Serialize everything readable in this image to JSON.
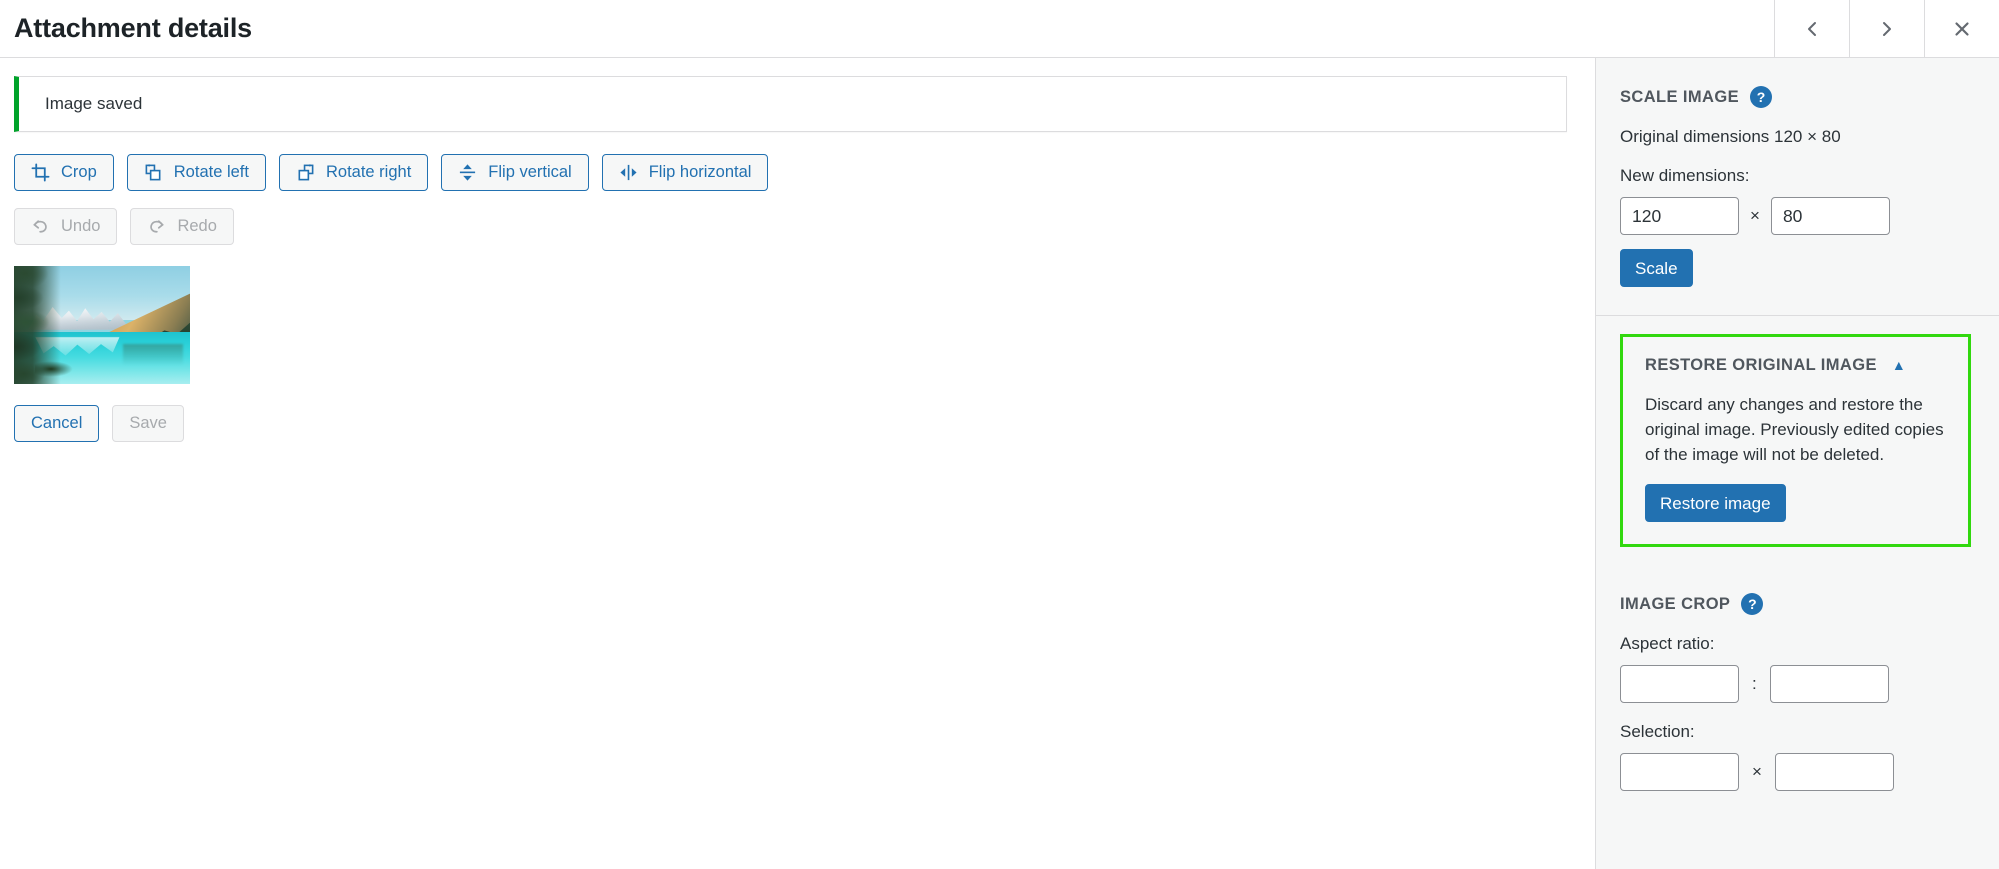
{
  "header": {
    "title": "Attachment details",
    "prev_label": "Previous",
    "prev_icon": "chevron-left-icon",
    "next_label": "Next",
    "next_icon": "chevron-right-icon",
    "close_label": "Close",
    "close_icon": "close-icon"
  },
  "notice": {
    "message": "Image saved",
    "accent_color": "#00a32a"
  },
  "toolbar": {
    "crop": {
      "label": "Crop",
      "icon": "crop-icon"
    },
    "rotate_left": {
      "label": "Rotate left",
      "icon": "rotate-left-icon"
    },
    "rotate_right": {
      "label": "Rotate right",
      "icon": "rotate-right-icon"
    },
    "flip_vertical": {
      "label": "Flip vertical",
      "icon": "flip-vertical-icon"
    },
    "flip_horizontal": {
      "label": "Flip horizontal",
      "icon": "flip-horizontal-icon"
    },
    "undo": {
      "label": "Undo",
      "icon": "undo-icon",
      "disabled": true
    },
    "redo": {
      "label": "Redo",
      "icon": "redo-icon",
      "disabled": true
    }
  },
  "preview": {
    "alt": "Mountain lake landscape thumbnail preview"
  },
  "actions": {
    "cancel_label": "Cancel",
    "save_label": "Save",
    "save_disabled": true
  },
  "sidebar": {
    "scale_image": {
      "title": "Scale Image",
      "help_glyph": "?",
      "original_dimensions": "Original dimensions 120 × 80",
      "new_dimensions_label": "New dimensions:",
      "width_value": "120",
      "height_value": "80",
      "separator": "×",
      "scale_button": "Scale"
    },
    "restore": {
      "title": "Restore original image",
      "toggle_glyph": "▲",
      "description": "Discard any changes and restore the original image. Previously edited copies of the image will not be deleted.",
      "restore_button": "Restore image",
      "highlight_color": "#31d80e"
    },
    "image_crop": {
      "title": "Image Crop",
      "help_glyph": "?",
      "aspect_ratio_label": "Aspect ratio:",
      "aspect_ratio_width": "",
      "aspect_ratio_height": "",
      "aspect_separator": ":",
      "selection_label": "Selection:",
      "selection_width": "",
      "selection_height": "",
      "selection_separator": "×"
    }
  }
}
